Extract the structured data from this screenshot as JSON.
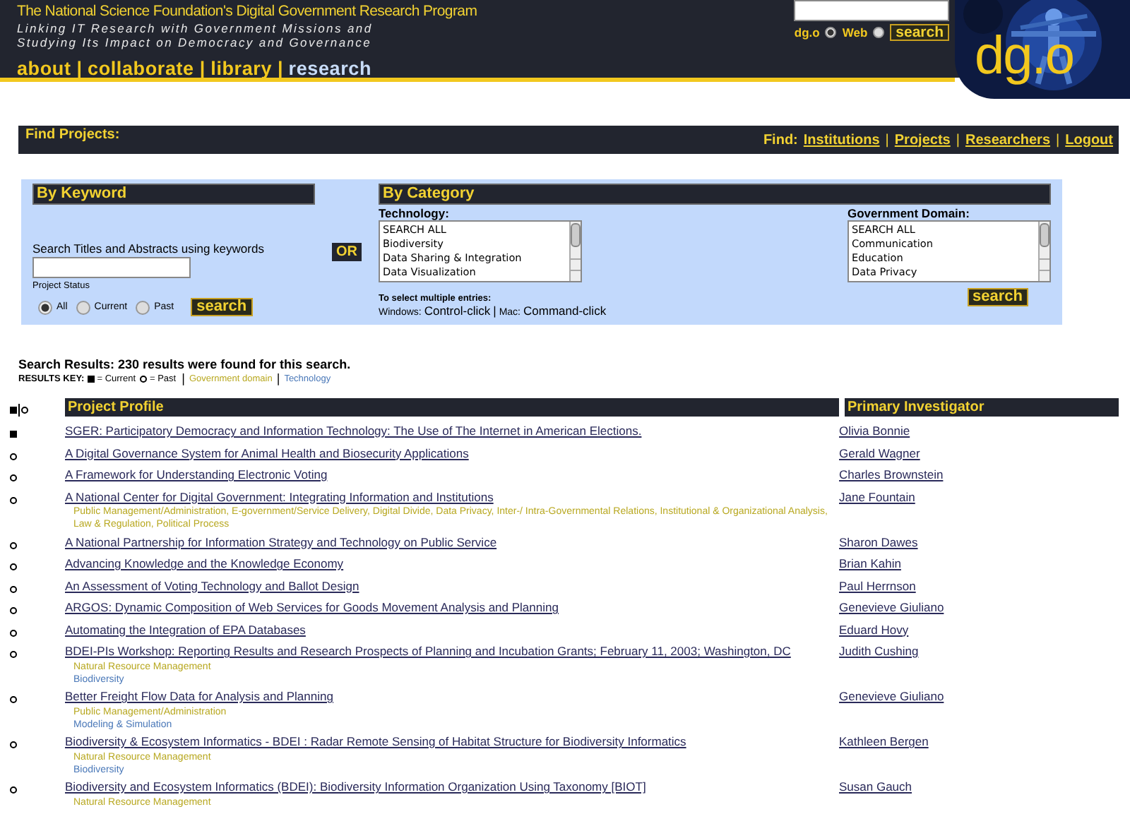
{
  "header": {
    "title": "The National Science Foundation's Digital Government Research Program",
    "tagline": [
      "Linking IT Research with Government Missions and",
      "Studying Its Impact on Democracy and Governance"
    ],
    "nav_separator": "|",
    "nav": [
      {
        "label": "about",
        "selected": false
      },
      {
        "label": "collaborate",
        "selected": false
      },
      {
        "label": "library",
        "selected": false
      },
      {
        "label": "research",
        "selected": true
      }
    ],
    "site_search": {
      "scopes": [
        {
          "label": "dg.o",
          "selected": true
        },
        {
          "label": "Web",
          "selected": false
        }
      ],
      "button": "search"
    },
    "logo": "dg.o"
  },
  "find_bar": {
    "title": "Find Projects:",
    "label": "Find:",
    "separator": "|",
    "links": [
      "Institutions",
      "Projects",
      "Researchers",
      "Logout"
    ]
  },
  "by_keyword": {
    "title": "By Keyword",
    "field_label": "Search Titles and Abstracts using keywords",
    "status_label": "Project Status",
    "statuses": [
      {
        "label": "All",
        "selected": true
      },
      {
        "label": "Current",
        "selected": false
      },
      {
        "label": "Past",
        "selected": false
      }
    ],
    "button": "search"
  },
  "or_label": "OR",
  "by_category": {
    "title": "By Category",
    "lists": [
      {
        "label": "Technology:",
        "options": [
          "SEARCH ALL",
          "Biodiversity",
          "Data Sharing & Integration",
          "Data Visualization"
        ]
      },
      {
        "label": "Government Domain:",
        "options": [
          "SEARCH ALL",
          "Communication",
          "Education",
          "Data Privacy"
        ]
      }
    ],
    "hint_title": "To select multiple entries:",
    "hint": [
      {
        "kind": "small",
        "text": "Windows:"
      },
      {
        "kind": "big",
        "text": "Control-click"
      },
      {
        "kind": "sep",
        "text": "|"
      },
      {
        "kind": "small",
        "text": "Mac:"
      },
      {
        "kind": "big",
        "text": "Command-click"
      }
    ],
    "button": "search"
  },
  "results": {
    "summary": "Search Results: 230 results were found for this search.",
    "key": [
      {
        "kind": "label",
        "text": "RESULTS KEY:"
      },
      {
        "kind": "current",
        "text": "= Current"
      },
      {
        "kind": "past",
        "text": "= Past"
      },
      {
        "kind": "sep",
        "text": "|"
      },
      {
        "kind": "domain",
        "text": "Government domain"
      },
      {
        "kind": "sep",
        "text": "|"
      },
      {
        "kind": "technology",
        "text": "Technology"
      }
    ]
  },
  "table": {
    "columns": [
      "Project Profile",
      "Primary Investigator"
    ],
    "rows": [
      {
        "current": true,
        "title": "SGER: Participatory Democracy and Information Technology: The Use of The Internet in American Elections.",
        "investigator": "Olivia Bonnie"
      },
      {
        "current": false,
        "title": "A Digital Governance System for Animal Health and Biosecurity Applications",
        "investigator": "Gerald Wagner"
      },
      {
        "current": false,
        "title": "A Framework for Understanding Electronic Voting",
        "investigator": "Charles Brownstein"
      },
      {
        "current": false,
        "title": "A National Center for Digital Government: Integrating Information and Institutions",
        "investigator": "Jane Fountain",
        "domains": "Public Management/Administration, E-government/Service Delivery, Digital Divide, Data Privacy, Inter-/ Intra-Governmental Relations, Institutional & Organizational Analysis, Law & Regulation, Political Process"
      },
      {
        "current": false,
        "title": "A National Partnership for Information Strategy and Technology on Public Service",
        "investigator": "Sharon Dawes"
      },
      {
        "current": false,
        "title": "Advancing Knowledge and the Knowledge Economy",
        "investigator": "Brian Kahin"
      },
      {
        "current": false,
        "title": "An Assessment of Voting Technology and Ballot Design",
        "investigator": "Paul Herrnson"
      },
      {
        "current": false,
        "title": "ARGOS: Dynamic Composition of Web Services for Goods Movement Analysis and Planning",
        "investigator": "Genevieve Giuliano"
      },
      {
        "current": false,
        "title": "Automating the Integration of EPA Databases",
        "investigator": "Eduard Hovy"
      },
      {
        "current": false,
        "title": "BDEI-PIs Workshop: Reporting Results and Research Prospects of Planning and Incubation Grants; February 11, 2003; Washington, DC",
        "investigator": "Judith Cushing",
        "domains": "Natural Resource Management",
        "technologies": "Biodiversity"
      },
      {
        "current": false,
        "title": "Better Freight Flow Data for Analysis and Planning",
        "investigator": "Genevieve Giuliano",
        "domains": "Public Management/Administration",
        "technologies": "Modeling & Simulation"
      },
      {
        "current": false,
        "title": "Biodiversity & Ecosystem Informatics - BDEI : Radar Remote Sensing of Habitat Structure for Biodiversity Informatics",
        "investigator": "Kathleen Bergen",
        "domains": "Natural Resource Management",
        "technologies": "Biodiversity"
      },
      {
        "current": false,
        "title": "Biodiversity and Ecosystem Informatics (BDEI): Biodiversity Information Organization Using Taxonomy [BIOT]",
        "investigator": "Susan Gauch",
        "domains": "Natural Resource Management"
      }
    ]
  }
}
